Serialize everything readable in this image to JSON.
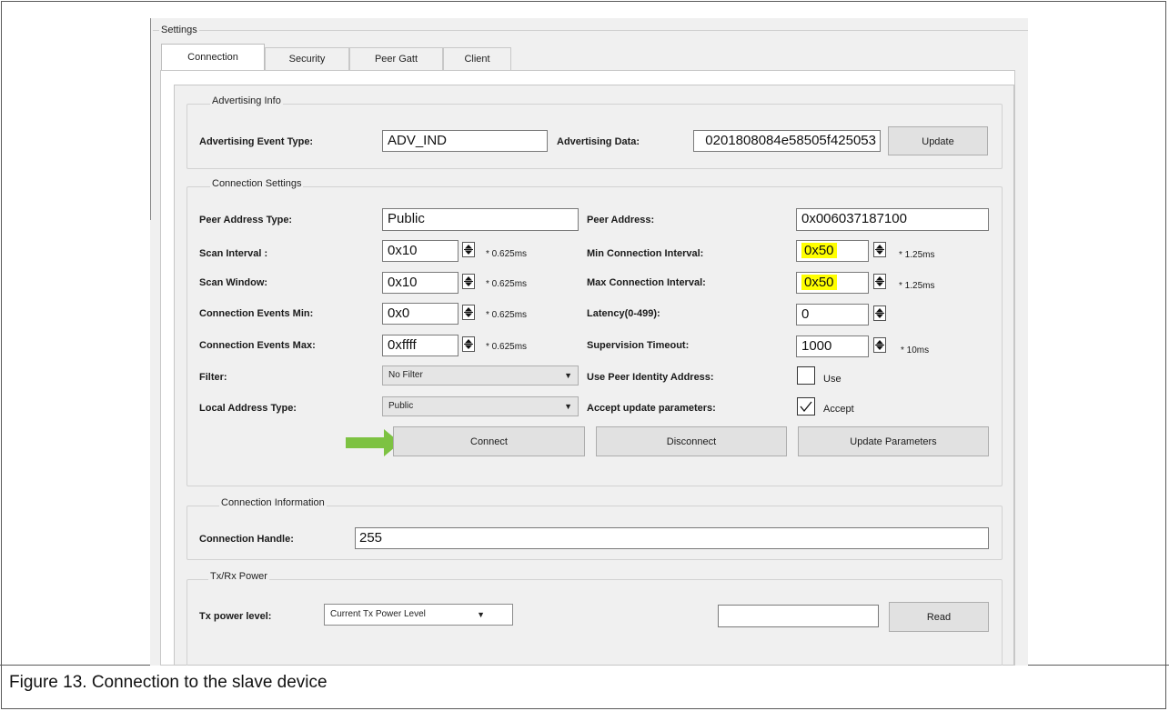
{
  "settings_title": "Settings",
  "tabs": [
    {
      "label": "Connection",
      "active": true
    },
    {
      "label": "Security",
      "active": false
    },
    {
      "label": "Peer Gatt",
      "active": false
    },
    {
      "label": "Client",
      "active": false
    }
  ],
  "advertising": {
    "group_title": "Advertising Info",
    "event_type_label": "Advertising Event Type:",
    "event_type_value": "ADV_IND",
    "data_label": "Advertising Data:",
    "data_value": "0201808084e58505f425053",
    "update_button": "Update"
  },
  "connection_settings": {
    "group_title": "Connection Settings",
    "peer_address_type_label": "Peer Address Type:",
    "peer_address_type_value": "Public",
    "peer_address_label": "Peer Address:",
    "peer_address_value": "0x006037187100",
    "scan_interval_label": "Scan Interval :",
    "scan_interval_value": "0x10",
    "scan_interval_unit": "* 0.625ms",
    "min_conn_interval_label": "Min Connection Interval:",
    "min_conn_interval_value": "0x50",
    "min_conn_interval_unit": "* 1.25ms",
    "scan_window_label": "Scan Window:",
    "scan_window_value": "0x10",
    "scan_window_unit": "* 0.625ms",
    "max_conn_interval_label": "Max Connection Interval:",
    "max_conn_interval_value": "0x50",
    "max_conn_interval_unit": "* 1.25ms",
    "conn_events_min_label": "Connection Events Min:",
    "conn_events_min_value": "0x0",
    "conn_events_min_unit": "* 0.625ms",
    "latency_label": "Latency(0-499):",
    "latency_value": "0",
    "conn_events_max_label": "Connection Events Max:",
    "conn_events_max_value": "0xffff",
    "conn_events_max_unit": "* 0.625ms",
    "supervision_timeout_label": "Supervision Timeout:",
    "supervision_timeout_value": "1000",
    "supervision_timeout_unit": "* 10ms",
    "filter_label": "Filter:",
    "filter_value": "No Filter",
    "use_peer_identity_label": "Use Peer Identity Address:",
    "use_checkbox_label": "Use",
    "use_checked": false,
    "local_address_type_label": "Local Address Type:",
    "local_address_type_value": "Public",
    "accept_update_label": "Accept update parameters:",
    "accept_checkbox_label": "Accept",
    "accept_checked": true,
    "connect_button": "Connect",
    "disconnect_button": "Disconnect",
    "update_parameters_button": "Update Parameters",
    "highlight_color": "#ffff00",
    "arrow_color": "#7dc242"
  },
  "connection_information": {
    "group_title": "Connection Information",
    "handle_label": "Connection Handle:",
    "handle_value": "255"
  },
  "txrx_power": {
    "group_title": "Tx/Rx Power",
    "tx_power_label": "Tx power level:",
    "tx_power_select": "Current Tx Power Level",
    "tx_power_value": "",
    "read_button": "Read"
  },
  "caption": "Figure 13.  Connection to the slave device"
}
